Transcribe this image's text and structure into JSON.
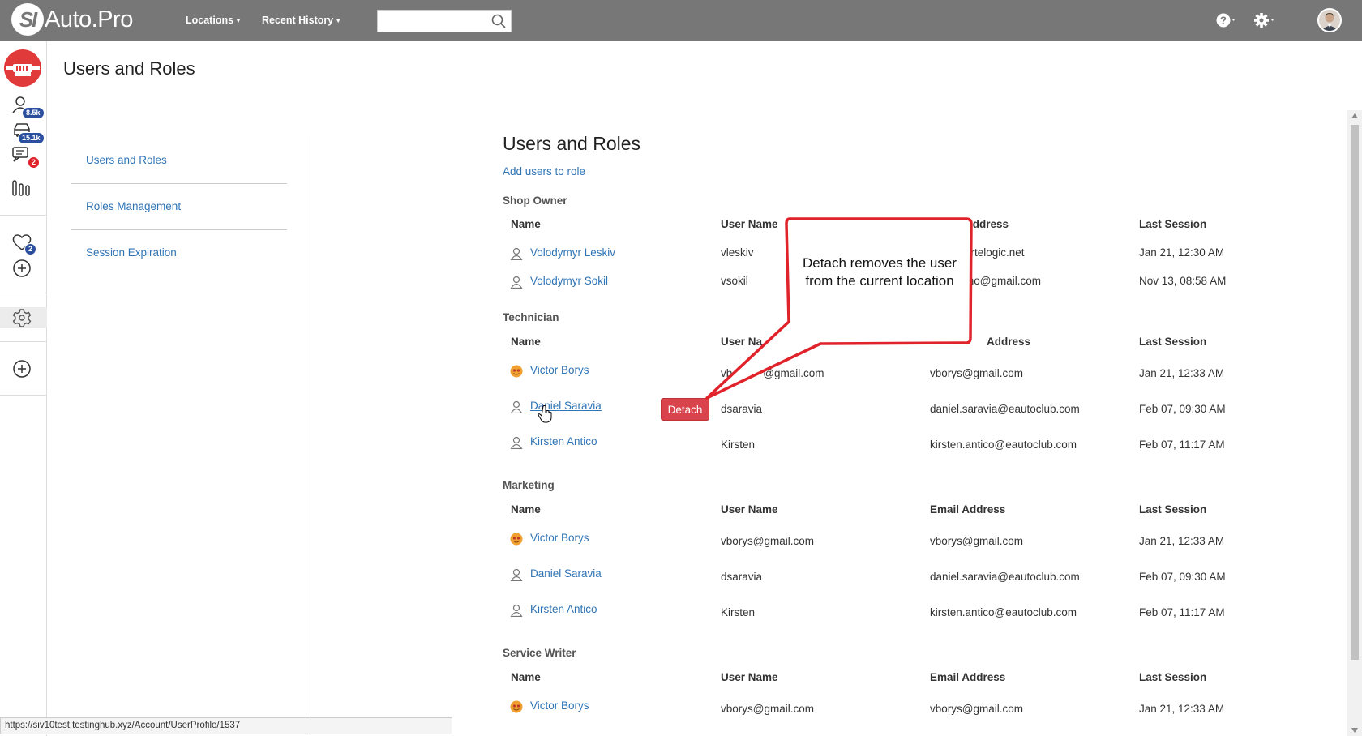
{
  "app": {
    "logo_mark": "SI",
    "logo_text": "Auto.Pro"
  },
  "topbar": {
    "locations_label": "Locations",
    "recent_history_label": "Recent History",
    "search": {
      "value": "",
      "placeholder": ""
    }
  },
  "rail": {
    "customers_badge": "8.5k",
    "vehicles_badge": "15.1k",
    "messages_badge": "2",
    "favorites_badge": "2"
  },
  "page": {
    "title": "Users and Roles"
  },
  "settings_menu": {
    "items": [
      {
        "label": "Users and Roles"
      },
      {
        "label": "Roles Management"
      },
      {
        "label": "Session Expiration"
      }
    ]
  },
  "content": {
    "title": "Users and Roles",
    "add_users_link": "Add users to role",
    "columns": {
      "name": "Name",
      "user_name": "User Name",
      "email": "Email Address",
      "last_session": "Last Session"
    },
    "sections": [
      {
        "title": "Shop Owner",
        "rows": [
          {
            "name": "Volodymyr Leskiv",
            "user_name": "vleskiv",
            "email": "artelogic.net",
            "last_session": "Jan 21, 12:30 AM",
            "icon": "user-outline-icon"
          },
          {
            "name": "Volodymyr Sokil",
            "user_name": "vsokil",
            "email": "mo@gmail.com",
            "last_session": "Nov 13, 08:58 AM",
            "icon": "user-outline-icon"
          }
        ]
      },
      {
        "title": "Technician",
        "rows": [
          {
            "name": "Victor Borys",
            "user_name": "vb",
            "user_name_tail": "@gmail.com",
            "email": "vborys@gmail.com",
            "last_session": "Jan 21, 12:33 AM",
            "icon": "avatar-photo-icon"
          },
          {
            "name": "Daniel Saravia",
            "user_name": "dsaravia",
            "email": "daniel.saravia@eautoclub.com",
            "last_session": "Feb 07, 09:30 AM",
            "icon": "user-outline-icon"
          },
          {
            "name": "Kirsten Antico",
            "user_name": "Kirsten",
            "email": "kirsten.antico@eautoclub.com",
            "last_session": "Feb 07, 11:17 AM",
            "icon": "user-outline-icon"
          }
        ]
      },
      {
        "title": "Marketing",
        "rows": [
          {
            "name": "Victor Borys",
            "user_name": "vborys@gmail.com",
            "email": "vborys@gmail.com",
            "last_session": "Jan 21, 12:33 AM",
            "icon": "avatar-photo-icon"
          },
          {
            "name": "Daniel Saravia",
            "user_name": "dsaravia",
            "email": "daniel.saravia@eautoclub.com",
            "last_session": "Feb 07, 09:30 AM",
            "icon": "user-outline-icon"
          },
          {
            "name": "Kirsten Antico",
            "user_name": "Kirsten",
            "email": "kirsten.antico@eautoclub.com",
            "last_session": "Feb 07, 11:17 AM",
            "icon": "user-outline-icon"
          }
        ]
      },
      {
        "title": "Service Writer",
        "rows": [
          {
            "name": "Victor Borys",
            "user_name": "vborys@gmail.com",
            "email": "vborys@gmail.com",
            "last_session": "Jan 21, 12:33 AM",
            "icon": "avatar-photo-icon"
          }
        ]
      }
    ],
    "detach_label": "Detach"
  },
  "callout": {
    "text": "Detach removes the user from the current location"
  },
  "statusbar": {
    "url": "https://siv10test.testinghub.xyz/Account/UserProfile/1537"
  },
  "colors": {
    "topbar": "#777777",
    "link": "#2f74b5",
    "detach": "#d9434b",
    "callout_border": "#e0222a"
  }
}
